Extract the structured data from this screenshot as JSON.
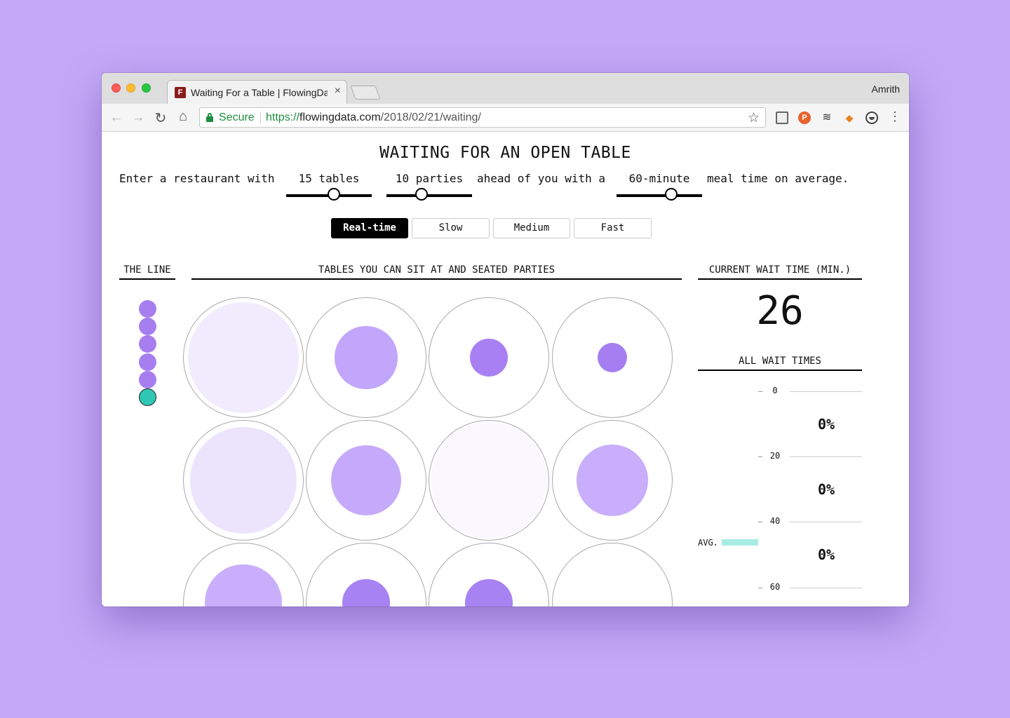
{
  "browser": {
    "tab_title": "Waiting For a Table | FlowingData",
    "tab_favicon": "F",
    "profile_name": "Amrith",
    "secure_label": "Secure",
    "url_protocol": "https://",
    "url_host": "flowingdata.com",
    "url_path": "/2018/02/21/waiting/",
    "icons": [
      "back-arrow-icon",
      "forward-arrow-icon",
      "reload-icon",
      "home-icon",
      "lock-icon",
      "star-icon",
      "tab-manager-icon",
      "pocket-icon",
      "buffer-icon",
      "metamask-icon",
      "extension-icon",
      "menu-icon"
    ]
  },
  "page": {
    "title": "WAITING FOR AN OPEN TABLE",
    "sentence": {
      "intro": "Enter a restaurant with",
      "tables_label": "15 tables",
      "parties_label": "10 parties",
      "mid": "ahead of you with a",
      "meal_label": "60-minute",
      "outro": "meal time on average."
    },
    "sliders": {
      "tables": {
        "value": 15,
        "fraction": 0.56
      },
      "parties": {
        "value": 10,
        "fraction": 0.41
      },
      "meal": {
        "value": 60,
        "fraction": 0.64
      }
    },
    "speed_buttons": [
      "Real-time",
      "Slow",
      "Medium",
      "Fast"
    ],
    "active_speed": "Real-time",
    "headers": {
      "line": "THE LINE",
      "tables": "TABLES YOU CAN SIT AT AND SEATED PARTIES",
      "current_wait": "CURRENT WAIT TIME (MIN.)",
      "all_waits": "ALL WAIT TIMES"
    },
    "line_count": 6,
    "current_wait": "26",
    "tables": [
      {
        "fill": 0.94,
        "color": "#f0ecfd"
      },
      {
        "fill": 0.53,
        "color": "#c2a6fb"
      },
      {
        "fill": 0.32,
        "color": "#a880f3"
      },
      {
        "fill": 0.25,
        "color": "#a57ef2"
      },
      {
        "fill": 0.9,
        "color": "#ece4fd"
      },
      {
        "fill": 0.6,
        "color": "#c5aafb"
      },
      {
        "fill": 0.99,
        "color": "#faf8fe"
      },
      {
        "fill": 0.61,
        "color": "#c8aefb"
      },
      {
        "fill": 0.65,
        "color": "#c9affb"
      },
      {
        "fill": 0.4,
        "color": "#a782f2"
      },
      {
        "fill": 0.4,
        "color": "#a782f2"
      },
      {
        "fill": 0.0,
        "color": "#ffffff"
      }
    ],
    "wait_axis": {
      "ticks": [
        "0",
        "20",
        "40",
        "60"
      ],
      "percents": [
        "0%",
        "0%",
        "0%"
      ],
      "avg_label": "AVG."
    }
  }
}
